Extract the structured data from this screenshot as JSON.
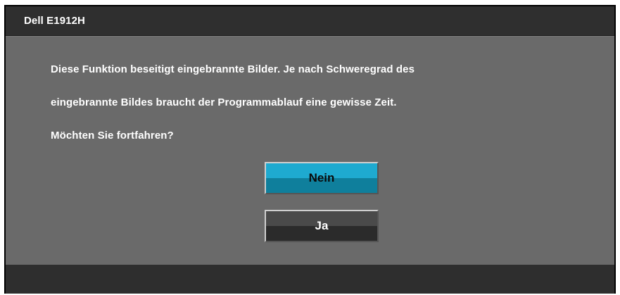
{
  "window": {
    "title": "Dell E1912H"
  },
  "message": {
    "line1": "Diese Funktion beseitigt eingebrannte Bilder. Je nach Schweregrad des",
    "line2": "eingebrannte Bildes braucht der Programmablauf eine gewisse Zeit.",
    "line3": "Möchten Sie fortfahren?"
  },
  "buttons": {
    "no_label": "Nein",
    "yes_label": "Ja"
  },
  "colors": {
    "selected_button": "#1eaad0",
    "unselected_button": "#3a3a3a",
    "panel_background": "#6a6a6a",
    "title_bar": "#2f2f2f"
  }
}
